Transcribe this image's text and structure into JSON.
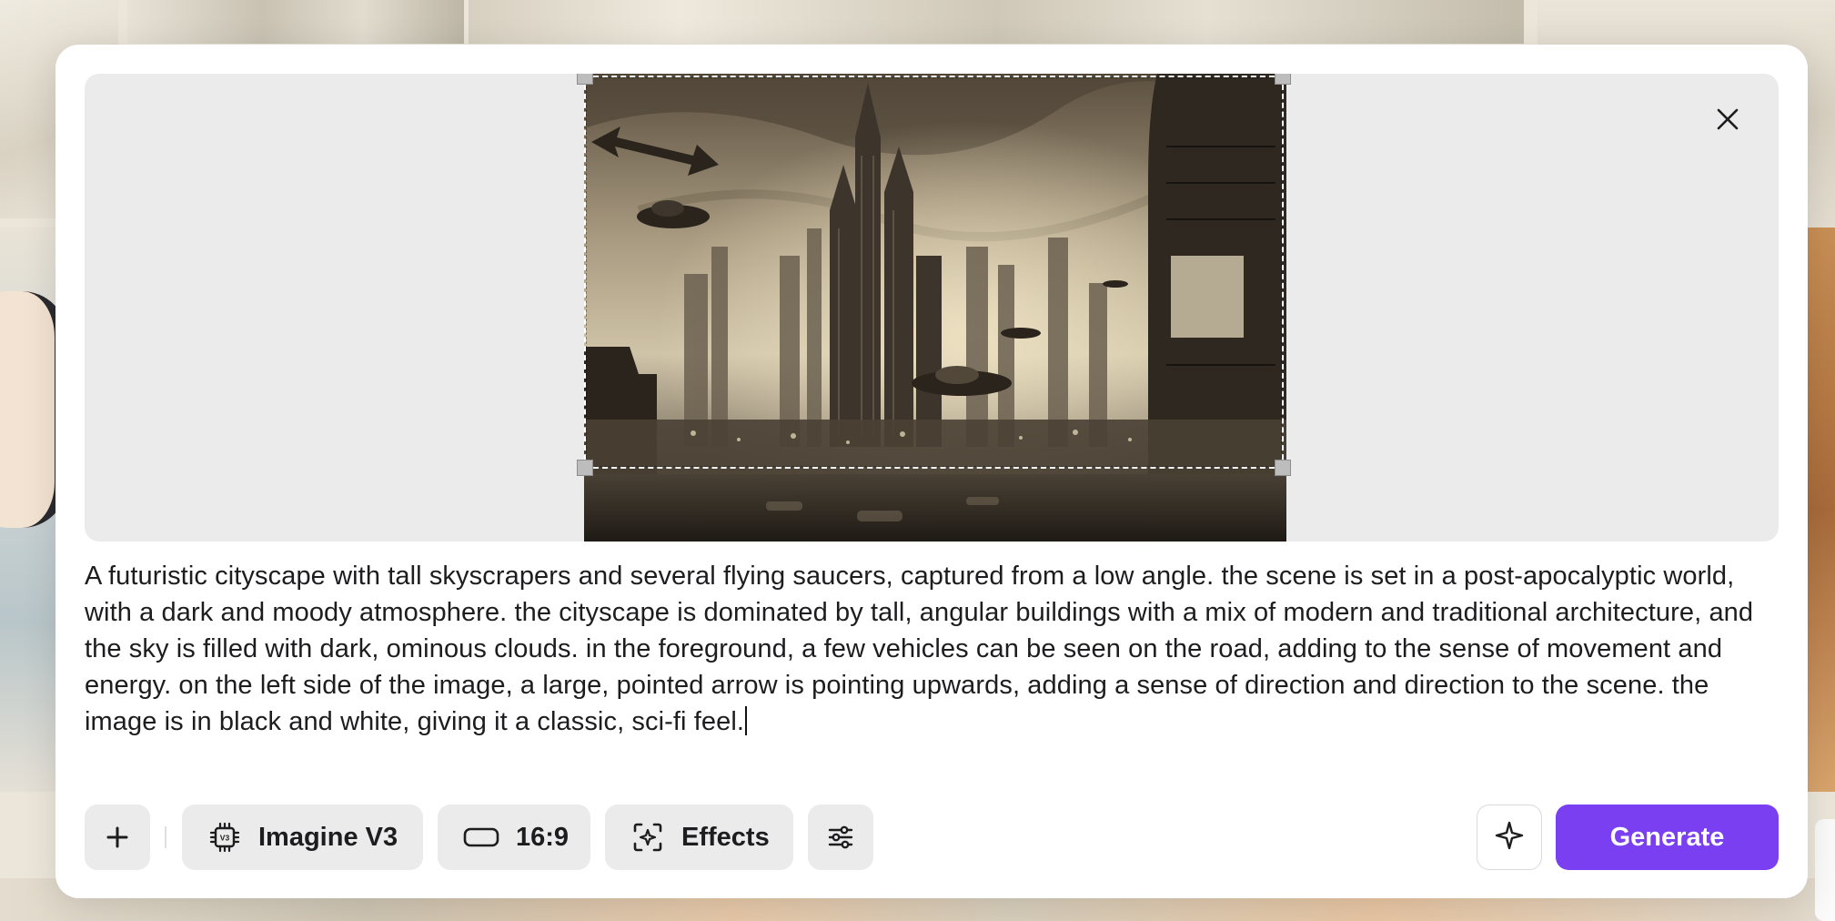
{
  "prompt": {
    "text": "A futuristic cityscape with tall skyscrapers and several flying saucers, captured from a low angle. the scene is set in a post-apocalyptic world, with a dark and moody atmosphere. the cityscape is dominated by tall, angular buildings with a mix of modern and traditional architecture, and the sky is filled with dark, ominous clouds. in the foreground, a few vehicles can be seen on the road, adding to the sense of movement and energy. on the left side of the image, a large, pointed arrow is pointing upwards, adding a sense of direction and direction to the scene. the image is in black and white, giving it a classic, sci-fi feel."
  },
  "toolbar": {
    "model_label": "Imagine V3",
    "ratio_label": "16:9",
    "effects_label": "Effects",
    "generate_label": "Generate"
  },
  "icons": {
    "close": "close-icon",
    "add": "plus-icon",
    "model": "chip-icon",
    "ratio": "aspect-ratio-icon",
    "effects": "effects-icon",
    "settings": "sliders-icon",
    "magic": "sparkle-icon"
  },
  "colors": {
    "accent": "#7a3ff0",
    "preview_bg": "#ebebeb",
    "button_bg": "#ebebeb"
  }
}
